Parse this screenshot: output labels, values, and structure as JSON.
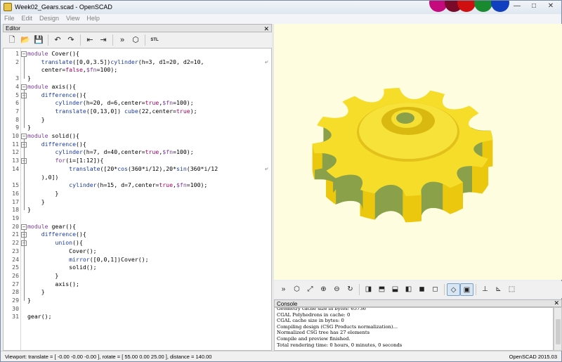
{
  "window": {
    "title": "Week02_Gears.scad - OpenSCAD",
    "minimize": "—",
    "maximize": "□",
    "close": "✕"
  },
  "menu": [
    "File",
    "Edit",
    "Design",
    "View",
    "Help"
  ],
  "editor": {
    "title": "Editor",
    "close": "✕",
    "toolbar": [
      {
        "name": "new-file-icon",
        "glyph": "🗋"
      },
      {
        "name": "open-file-icon",
        "glyph": "📂"
      },
      {
        "name": "save-file-icon",
        "glyph": "💾"
      },
      {
        "name": "undo-icon",
        "glyph": "↶"
      },
      {
        "name": "redo-icon",
        "glyph": "↷"
      },
      {
        "name": "unindent-icon",
        "glyph": "⇤"
      },
      {
        "name": "indent-icon",
        "glyph": "⇥"
      },
      {
        "name": "preview-icon",
        "glyph": "»"
      },
      {
        "name": "render-icon",
        "glyph": "⬡"
      },
      {
        "name": "export-stl-icon",
        "glyph": "STL"
      }
    ],
    "lines": [
      {
        "n": "1",
        "fold": "start",
        "text": "module Cover(){"
      },
      {
        "n": "2",
        "text": "    translate([0,0,3.5])cylinder(h=3, d1=20, d2=10,",
        "wrap": true
      },
      {
        "n": "",
        "text": "    center=false,$fn=100);"
      },
      {
        "n": "3",
        "fold": "end",
        "text": "}"
      },
      {
        "n": "4",
        "fold": "start",
        "text": "module axis(){"
      },
      {
        "n": "5",
        "fold": "start",
        "text": "    difference(){"
      },
      {
        "n": "6",
        "text": "        cylinder(h=20, d=6,center=true,$fn=100);"
      },
      {
        "n": "7",
        "text": "        translate([0,13,0]) cube(22,center=true);"
      },
      {
        "n": "8",
        "fold": "end",
        "text": "    }"
      },
      {
        "n": "9",
        "fold": "end",
        "text": "}"
      },
      {
        "n": "10",
        "fold": "start",
        "text": "module solid(){"
      },
      {
        "n": "11",
        "fold": "start",
        "text": "    difference(){"
      },
      {
        "n": "12",
        "text": "        cylinder(h=7, d=40,center=true,$fn=100);"
      },
      {
        "n": "13",
        "fold": "start",
        "text": "        for(i=[1:12]){"
      },
      {
        "n": "14",
        "text": "            translate([20*cos(360*i/12),20*sin(360*i/12",
        "wrap": true
      },
      {
        "n": "",
        "text": "    ),0])"
      },
      {
        "n": "15",
        "text": "            cylinder(h=15, d=7,center=true,$fn=100);"
      },
      {
        "n": "16",
        "fold": "end",
        "text": "        }"
      },
      {
        "n": "17",
        "fold": "end",
        "text": "    }"
      },
      {
        "n": "18",
        "fold": "end",
        "text": "}"
      },
      {
        "n": "19",
        "text": ""
      },
      {
        "n": "20",
        "fold": "start",
        "text": "module gear(){"
      },
      {
        "n": "21",
        "fold": "start",
        "text": "    difference(){"
      },
      {
        "n": "22",
        "fold": "start",
        "text": "        union(){"
      },
      {
        "n": "23",
        "text": "            Cover();"
      },
      {
        "n": "24",
        "text": "            mirror([0,0,1])Cover();"
      },
      {
        "n": "25",
        "text": "            solid();"
      },
      {
        "n": "26",
        "fold": "end",
        "text": "        }"
      },
      {
        "n": "27",
        "text": "        axis();"
      },
      {
        "n": "28",
        "fold": "end",
        "text": "    }"
      },
      {
        "n": "29",
        "fold": "end",
        "text": "}"
      },
      {
        "n": "30",
        "text": ""
      },
      {
        "n": "31",
        "text": "gear();"
      }
    ]
  },
  "viewer_toolbar": [
    {
      "name": "preview-icon",
      "glyph": "»"
    },
    {
      "name": "render-icon",
      "glyph": "⬡"
    },
    {
      "name": "view-all-icon",
      "glyph": "⤢"
    },
    {
      "name": "zoom-in-icon",
      "glyph": "⊕"
    },
    {
      "name": "zoom-out-icon",
      "glyph": "⊖"
    },
    {
      "name": "reset-view-icon",
      "glyph": "↻"
    },
    {
      "name": "view-right-icon",
      "glyph": "◨"
    },
    {
      "name": "view-top-icon",
      "glyph": "⬒"
    },
    {
      "name": "view-bottom-icon",
      "glyph": "⬓"
    },
    {
      "name": "view-left-icon",
      "glyph": "◧"
    },
    {
      "name": "view-front-icon",
      "glyph": "◼"
    },
    {
      "name": "view-back-icon",
      "glyph": "◻"
    },
    {
      "name": "perspective-icon",
      "glyph": "◇",
      "active": true
    },
    {
      "name": "orthogonal-icon",
      "glyph": "▣",
      "active": true
    },
    {
      "name": "show-axes-icon",
      "glyph": "⊥"
    },
    {
      "name": "show-scale-icon",
      "glyph": "⊾"
    },
    {
      "name": "show-edges-icon",
      "glyph": "⬚"
    }
  ],
  "console": {
    "title": "Console",
    "close": "✕",
    "lines": [
      "Geometry cache size in bytes: 65736",
      "CGAL Polyhedrons in cache: 0",
      "CGAL cache size in bytes: 0",
      "Compiling design (CSG Products normalization)...",
      "Normalized CSG tree has 27 elements",
      "Compile and preview finished.",
      "Total rendering time: 0 hours, 0 minutes, 0 seconds"
    ]
  },
  "status": {
    "viewport": "Viewport: translate = [ -0.00 -0.00 -0.00 ], rotate = [ 55.00 0.00 25.00 ], distance = 140.00",
    "version": "OpenSCAD 2015.03"
  },
  "colors": {
    "viewport_bg": "#fffde0",
    "gear_top": "#f5dd2a",
    "gear_side": "#ebc80e",
    "gear_hole": "#8aa14a"
  }
}
